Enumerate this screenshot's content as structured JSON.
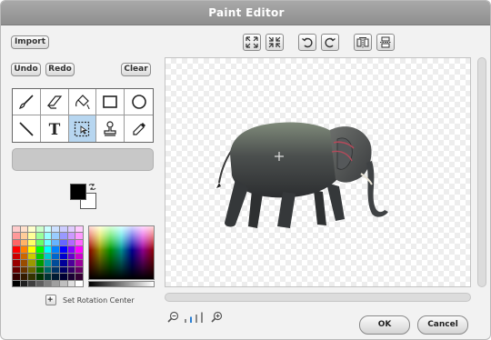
{
  "window": {
    "title": "Paint Editor"
  },
  "buttons": {
    "import": "Import",
    "undo": "Undo",
    "redo": "Redo",
    "clear": "Clear",
    "ok": "OK",
    "cancel": "Cancel"
  },
  "toolbar": [
    "enlarge-icon",
    "shrink-icon",
    "rotate-left-icon",
    "rotate-right-icon",
    "flip-horizontal-icon",
    "flip-vertical-icon"
  ],
  "tools": [
    {
      "name": "paintbrush-icon",
      "selected": false
    },
    {
      "name": "eraser-icon",
      "selected": false
    },
    {
      "name": "fill-bucket-icon",
      "selected": false
    },
    {
      "name": "rectangle-icon",
      "selected": false
    },
    {
      "name": "ellipse-icon",
      "selected": false
    },
    {
      "name": "line-icon",
      "selected": false
    },
    {
      "name": "text-icon",
      "selected": false
    },
    {
      "name": "select-icon",
      "selected": true
    },
    {
      "name": "stamp-icon",
      "selected": false
    },
    {
      "name": "eyedropper-icon",
      "selected": false
    }
  ],
  "text_tool_glyph": "T",
  "colors": {
    "foreground": "#000000",
    "background": "#ffffff",
    "selected_tool": "#b7d6f0"
  },
  "palette": [
    "#ffcccc",
    "#ffe0cc",
    "#ffffcc",
    "#ccffcc",
    "#ccffff",
    "#cce0ff",
    "#ccccff",
    "#e0ccff",
    "#ffccff",
    "#ff9999",
    "#ffcc99",
    "#ffff99",
    "#99ff99",
    "#99ffff",
    "#99ccff",
    "#9999ff",
    "#cc99ff",
    "#ff99ff",
    "#ff6666",
    "#ffb366",
    "#ffff66",
    "#66ff66",
    "#66ffff",
    "#66b3ff",
    "#6666ff",
    "#b366ff",
    "#ff66ff",
    "#ff0000",
    "#ff8000",
    "#ffff00",
    "#00ff00",
    "#00ffff",
    "#0080ff",
    "#0000ff",
    "#8000ff",
    "#ff00ff",
    "#cc0000",
    "#cc6600",
    "#cccc00",
    "#00cc00",
    "#00cccc",
    "#0066cc",
    "#0000cc",
    "#6600cc",
    "#cc00cc",
    "#990000",
    "#994c00",
    "#999900",
    "#009900",
    "#009999",
    "#004c99",
    "#000099",
    "#4c0099",
    "#990099",
    "#660000",
    "#663300",
    "#666600",
    "#006600",
    "#006666",
    "#003366",
    "#000066",
    "#330066",
    "#660066",
    "#330000",
    "#331a00",
    "#333300",
    "#003300",
    "#003333",
    "#001a33",
    "#000033",
    "#1a0033",
    "#330033",
    "#000000",
    "#1f1f1f",
    "#3f3f3f",
    "#5f5f5f",
    "#7f7f7f",
    "#9f9f9f",
    "#bfbfbf",
    "#dfdfdf",
    "#ffffff"
  ],
  "rotation_center": {
    "label": "Set Rotation Center"
  },
  "zoom": {
    "levels": 4,
    "current": 1
  }
}
